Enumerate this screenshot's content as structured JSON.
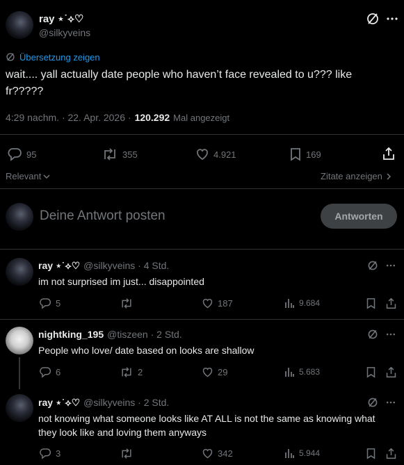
{
  "post": {
    "author_name": "ray ⋆˙⟡♡",
    "author_handle": "@silkyveins",
    "translate_label": "Übersetzung zeigen",
    "text": "wait.... yall actually date people who haven’t face revealed to u??? like fr?????",
    "time": "4:29 nachm. · 22. Apr. 2026 ·",
    "views": "120.292",
    "views_label": "Mal angezeigt",
    "stats": {
      "replies": "95",
      "reposts": "355",
      "likes": "4.921",
      "bookmarks": "169"
    }
  },
  "sort": {
    "label": "Relevant",
    "quotes_label": "Zitate anzeigen"
  },
  "compose": {
    "placeholder": "Deine Antwort posten",
    "button_label": "Antworten"
  },
  "replies": [
    {
      "name": "ray ⋆˙⟡♡",
      "handle": "@silkyveins · 4 Std.",
      "text": "im not surprised im just... disappointed",
      "replies": "5",
      "reposts": "",
      "likes": "187",
      "views": "9.684"
    },
    {
      "name": "nightking_195",
      "handle": "@tiszeen · 2 Std.",
      "text": "People who love/ date based on looks are shallow",
      "replies": "6",
      "reposts": "2",
      "likes": "29",
      "views": "5.683"
    },
    {
      "name": "ray ⋆˙⟡♡",
      "handle": "@silkyveins · 2 Std.",
      "text": "not knowing what someone looks like AT ALL is not the same as knowing what they look like and loving them anyways",
      "replies": "3",
      "reposts": "",
      "likes": "342",
      "views": "5.944"
    }
  ],
  "colors": {
    "accent": "#1d9bf0",
    "background": "#000000",
    "muted": "#71767b",
    "divider": "#2f3336"
  }
}
